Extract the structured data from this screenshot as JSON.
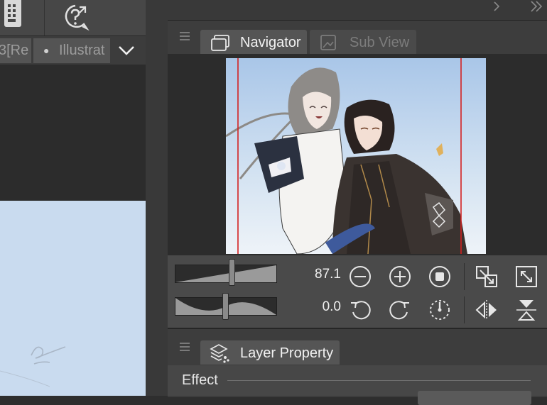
{
  "left_toolbar": {
    "icons": [
      "device-icon",
      "help-icon"
    ]
  },
  "document_tabs": [
    {
      "label": "3[Re",
      "active": false
    },
    {
      "label": "Illustrat",
      "active": true,
      "modified_dot": "●"
    }
  ],
  "panel_strip": {
    "collapse_left": "«",
    "collapse_right": "»",
    "next": "›"
  },
  "navigator": {
    "tabs": [
      {
        "label": "Navigator",
        "icon": "navigator-icon",
        "active": true
      },
      {
        "label": "Sub View",
        "icon": "subview-icon",
        "active": false
      }
    ],
    "zoom": {
      "value": "87.1",
      "slider_fraction": 0.56
    },
    "rotate": {
      "value": "0.0",
      "slider_fraction": 0.5
    },
    "buttons": [
      "zoom-out",
      "zoom-in",
      "stop",
      "fit-window",
      "actual-size",
      "rotate-left",
      "rotate-right",
      "reset-rotation",
      "flip-horizontal",
      "flip-vertical"
    ]
  },
  "layer_property": {
    "tab_label": "Layer Property",
    "effect_label": "Effect"
  },
  "colors": {
    "panel_bg": "#3d3d3d",
    "tab_active": "#555555",
    "frame_red": "#d42020",
    "canvas_sky": "#c9dbef"
  }
}
